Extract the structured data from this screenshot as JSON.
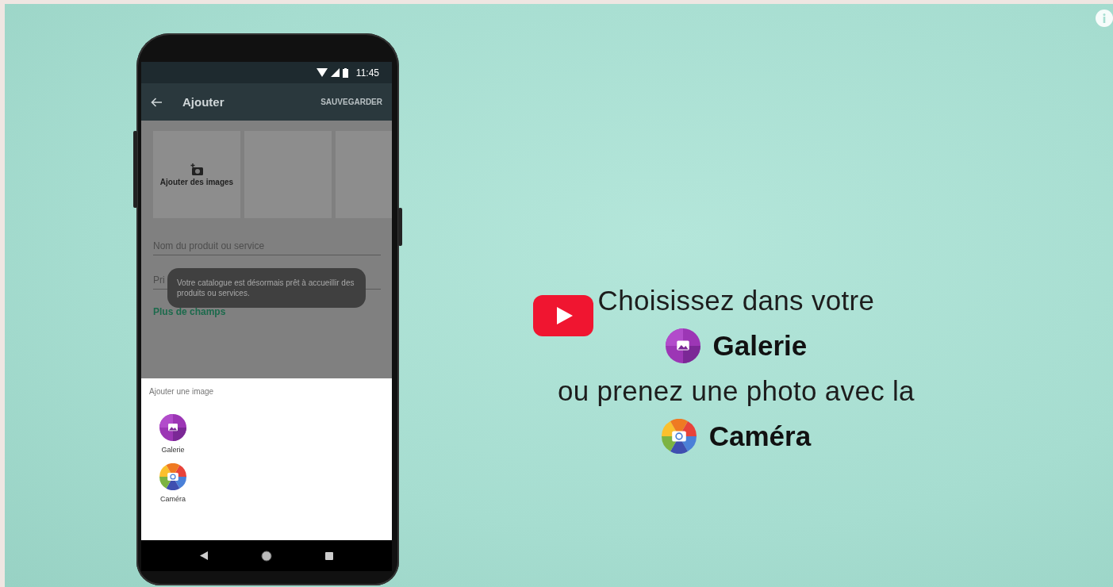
{
  "phone": {
    "status_bar": {
      "time": "11:45"
    },
    "app_bar": {
      "title": "Ajouter",
      "action": "SAUVEGARDER"
    },
    "image_tiles": [
      {
        "kind": "add",
        "label": "Ajouter des images"
      },
      {
        "kind": "empty"
      },
      {
        "kind": "empty"
      }
    ],
    "fields": [
      {
        "placeholder": "Nom du produit ou service"
      },
      {
        "placeholder": "Pri"
      }
    ],
    "more_link": "Plus de champs",
    "toast": "Votre catalogue est désormais prêt à accueillir des produits ou services.",
    "sheet": {
      "title": "Ajouter une image",
      "options": [
        {
          "kind": "gallery",
          "label": "Galerie"
        },
        {
          "kind": "camera",
          "label": "Caméra"
        }
      ]
    }
  },
  "caption": [
    {
      "kind": "text",
      "text": "Choisissez dans votre"
    },
    {
      "kind": "gallery",
      "text": "Galerie"
    },
    {
      "kind": "text",
      "text": "ou prenez une photo avec la"
    },
    {
      "kind": "camera",
      "text": "Caméra"
    }
  ]
}
